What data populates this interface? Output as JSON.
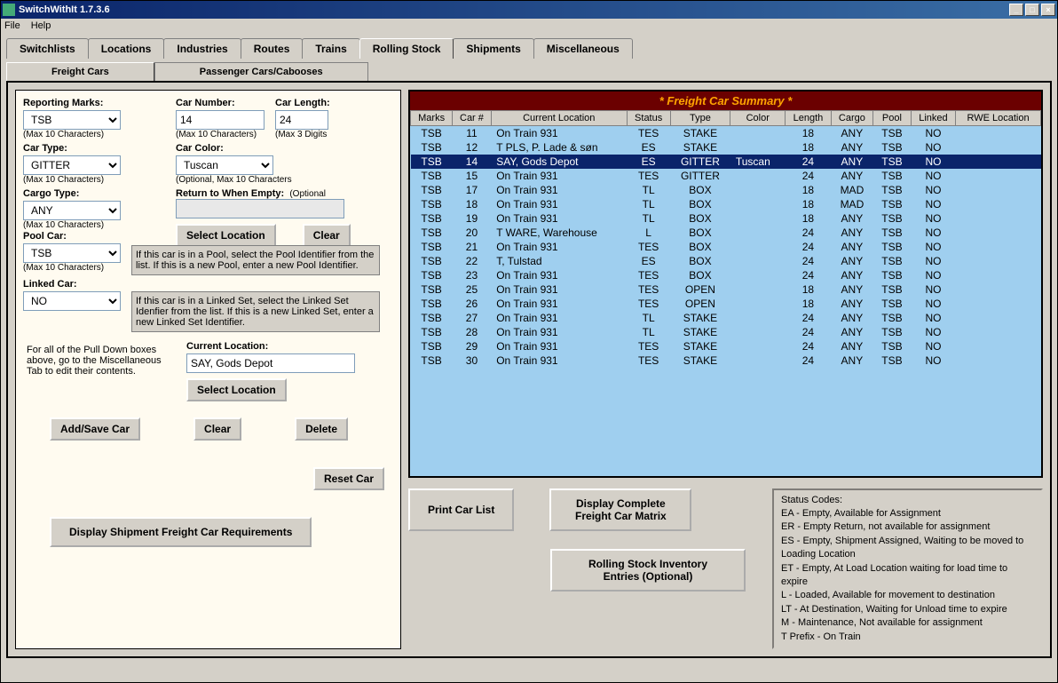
{
  "window": {
    "title": "SwitchWithIt 1.7.3.6"
  },
  "menu": {
    "file": "File",
    "help": "Help"
  },
  "tabs": [
    "Switchlists",
    "Locations",
    "Industries",
    "Routes",
    "Trains",
    "Rolling Stock",
    "Shipments",
    "Miscellaneous"
  ],
  "active_tab": "Rolling Stock",
  "subtabs": [
    "Freight Cars",
    "Passenger Cars/Cabooses"
  ],
  "active_subtab": "Freight Cars",
  "form": {
    "reporting_marks": {
      "label": "Reporting Marks:",
      "value": "TSB",
      "hint": "(Max 10 Characters)"
    },
    "car_number": {
      "label": "Car Number:",
      "value": "14",
      "hint": "(Max 10 Characters)"
    },
    "car_length": {
      "label": "Car Length:",
      "value": "24",
      "hint": "(Max 3 Digits"
    },
    "car_type": {
      "label": "Car Type:",
      "value": "GITTER",
      "hint": "(Max 10 Characters)"
    },
    "car_color": {
      "label": "Car Color:",
      "value": "Tuscan",
      "hint": "(Optional, Max 10 Characters"
    },
    "cargo_type": {
      "label": "Cargo Type:",
      "value": "ANY",
      "hint": "(Max 10 Characters)"
    },
    "return_empty": {
      "label": "Return to When Empty:",
      "hint": "(Optional",
      "value": ""
    },
    "select_location": "Select Location",
    "clear": "Clear",
    "pool_car": {
      "label": "Pool Car:",
      "value": "TSB",
      "hint": "(Max 10 Characters)"
    },
    "pool_hint": "If this car is in a Pool, select the Pool Identifier from the list.  If this is a new Pool, enter a new Pool Identifier.",
    "linked_car": {
      "label": "Linked Car:",
      "value": "NO"
    },
    "linked_hint": "If this car is in a Linked Set, select the Linked Set Idenfier from the list.  If this is a new Linked Set, enter a new Linked Set Identifier.",
    "pulldown_hint": "For all of the Pull Down boxes above, go to the Miscellaneous Tab to edit their contents.",
    "current_location": {
      "label": "Current Location:",
      "value": "SAY, Gods Depot"
    },
    "add_save": "Add/Save Car",
    "clear_btn": "Clear",
    "delete": "Delete",
    "reset": "Reset Car",
    "display_shipment": "Display Shipment Freight Car Requirements"
  },
  "table": {
    "title": "* Freight Car Summary *",
    "headers": [
      "Marks",
      "Car #",
      "Current Location",
      "Status",
      "Type",
      "Color",
      "Length",
      "Cargo",
      "Pool",
      "Linked",
      "RWE Location"
    ],
    "selected_index": 2,
    "rows": [
      [
        "TSB",
        "11",
        "On Train 931",
        "TES",
        "STAKE",
        "",
        "18",
        "ANY",
        "TSB",
        "NO",
        ""
      ],
      [
        "TSB",
        "12",
        "T PLS, P. Lade & søn",
        "ES",
        "STAKE",
        "",
        "18",
        "ANY",
        "TSB",
        "NO",
        ""
      ],
      [
        "TSB",
        "14",
        "SAY, Gods Depot",
        "ES",
        "GITTER",
        "Tuscan",
        "24",
        "ANY",
        "TSB",
        "NO",
        ""
      ],
      [
        "TSB",
        "15",
        "On Train 931",
        "TES",
        "GITTER",
        "",
        "24",
        "ANY",
        "TSB",
        "NO",
        ""
      ],
      [
        "TSB",
        "17",
        "On Train 931",
        "TL",
        "BOX",
        "",
        "18",
        "MAD",
        "TSB",
        "NO",
        ""
      ],
      [
        "TSB",
        "18",
        "On Train 931",
        "TL",
        "BOX",
        "",
        "18",
        "MAD",
        "TSB",
        "NO",
        ""
      ],
      [
        "TSB",
        "19",
        "On Train 931",
        "TL",
        "BOX",
        "",
        "18",
        "ANY",
        "TSB",
        "NO",
        ""
      ],
      [
        "TSB",
        "20",
        "T WARE, Warehouse",
        "L",
        "BOX",
        "",
        "24",
        "ANY",
        "TSB",
        "NO",
        ""
      ],
      [
        "TSB",
        "21",
        "On Train 931",
        "TES",
        "BOX",
        "",
        "24",
        "ANY",
        "TSB",
        "NO",
        ""
      ],
      [
        "TSB",
        "22",
        "T, Tulstad",
        "ES",
        "BOX",
        "",
        "24",
        "ANY",
        "TSB",
        "NO",
        ""
      ],
      [
        "TSB",
        "23",
        "On Train 931",
        "TES",
        "BOX",
        "",
        "24",
        "ANY",
        "TSB",
        "NO",
        ""
      ],
      [
        "TSB",
        "25",
        "On Train 931",
        "TES",
        "OPEN",
        "",
        "18",
        "ANY",
        "TSB",
        "NO",
        ""
      ],
      [
        "TSB",
        "26",
        "On Train 931",
        "TES",
        "OPEN",
        "",
        "18",
        "ANY",
        "TSB",
        "NO",
        ""
      ],
      [
        "TSB",
        "27",
        "On Train 931",
        "TL",
        "STAKE",
        "",
        "24",
        "ANY",
        "TSB",
        "NO",
        ""
      ],
      [
        "TSB",
        "28",
        "On Train 931",
        "TL",
        "STAKE",
        "",
        "24",
        "ANY",
        "TSB",
        "NO",
        ""
      ],
      [
        "TSB",
        "29",
        "On Train 931",
        "TES",
        "STAKE",
        "",
        "24",
        "ANY",
        "TSB",
        "NO",
        ""
      ],
      [
        "TSB",
        "30",
        "On Train 931",
        "TES",
        "STAKE",
        "",
        "24",
        "ANY",
        "TSB",
        "NO",
        ""
      ]
    ]
  },
  "buttons": {
    "print_car_list": "Print Car List",
    "display_matrix": "Display Complete Freight Car Matrix",
    "rolling_stock_inv": "Rolling Stock Inventory Entries (Optional)"
  },
  "status": {
    "title": "Status Codes:",
    "lines": [
      "EA - Empty, Available for Assignment",
      "ER - Empty Return, not available for assignment",
      "ES - Empty, Shipment Assigned, Waiting to be moved to Loading Location",
      "ET - Empty, At Load Location waiting for load time to expire",
      "L - Loaded, Available for movement to destination",
      "LT - At Destination, Waiting for Unload time to expire",
      "M - Maintenance, Not available for assignment",
      "T Prefix - On Train"
    ]
  }
}
